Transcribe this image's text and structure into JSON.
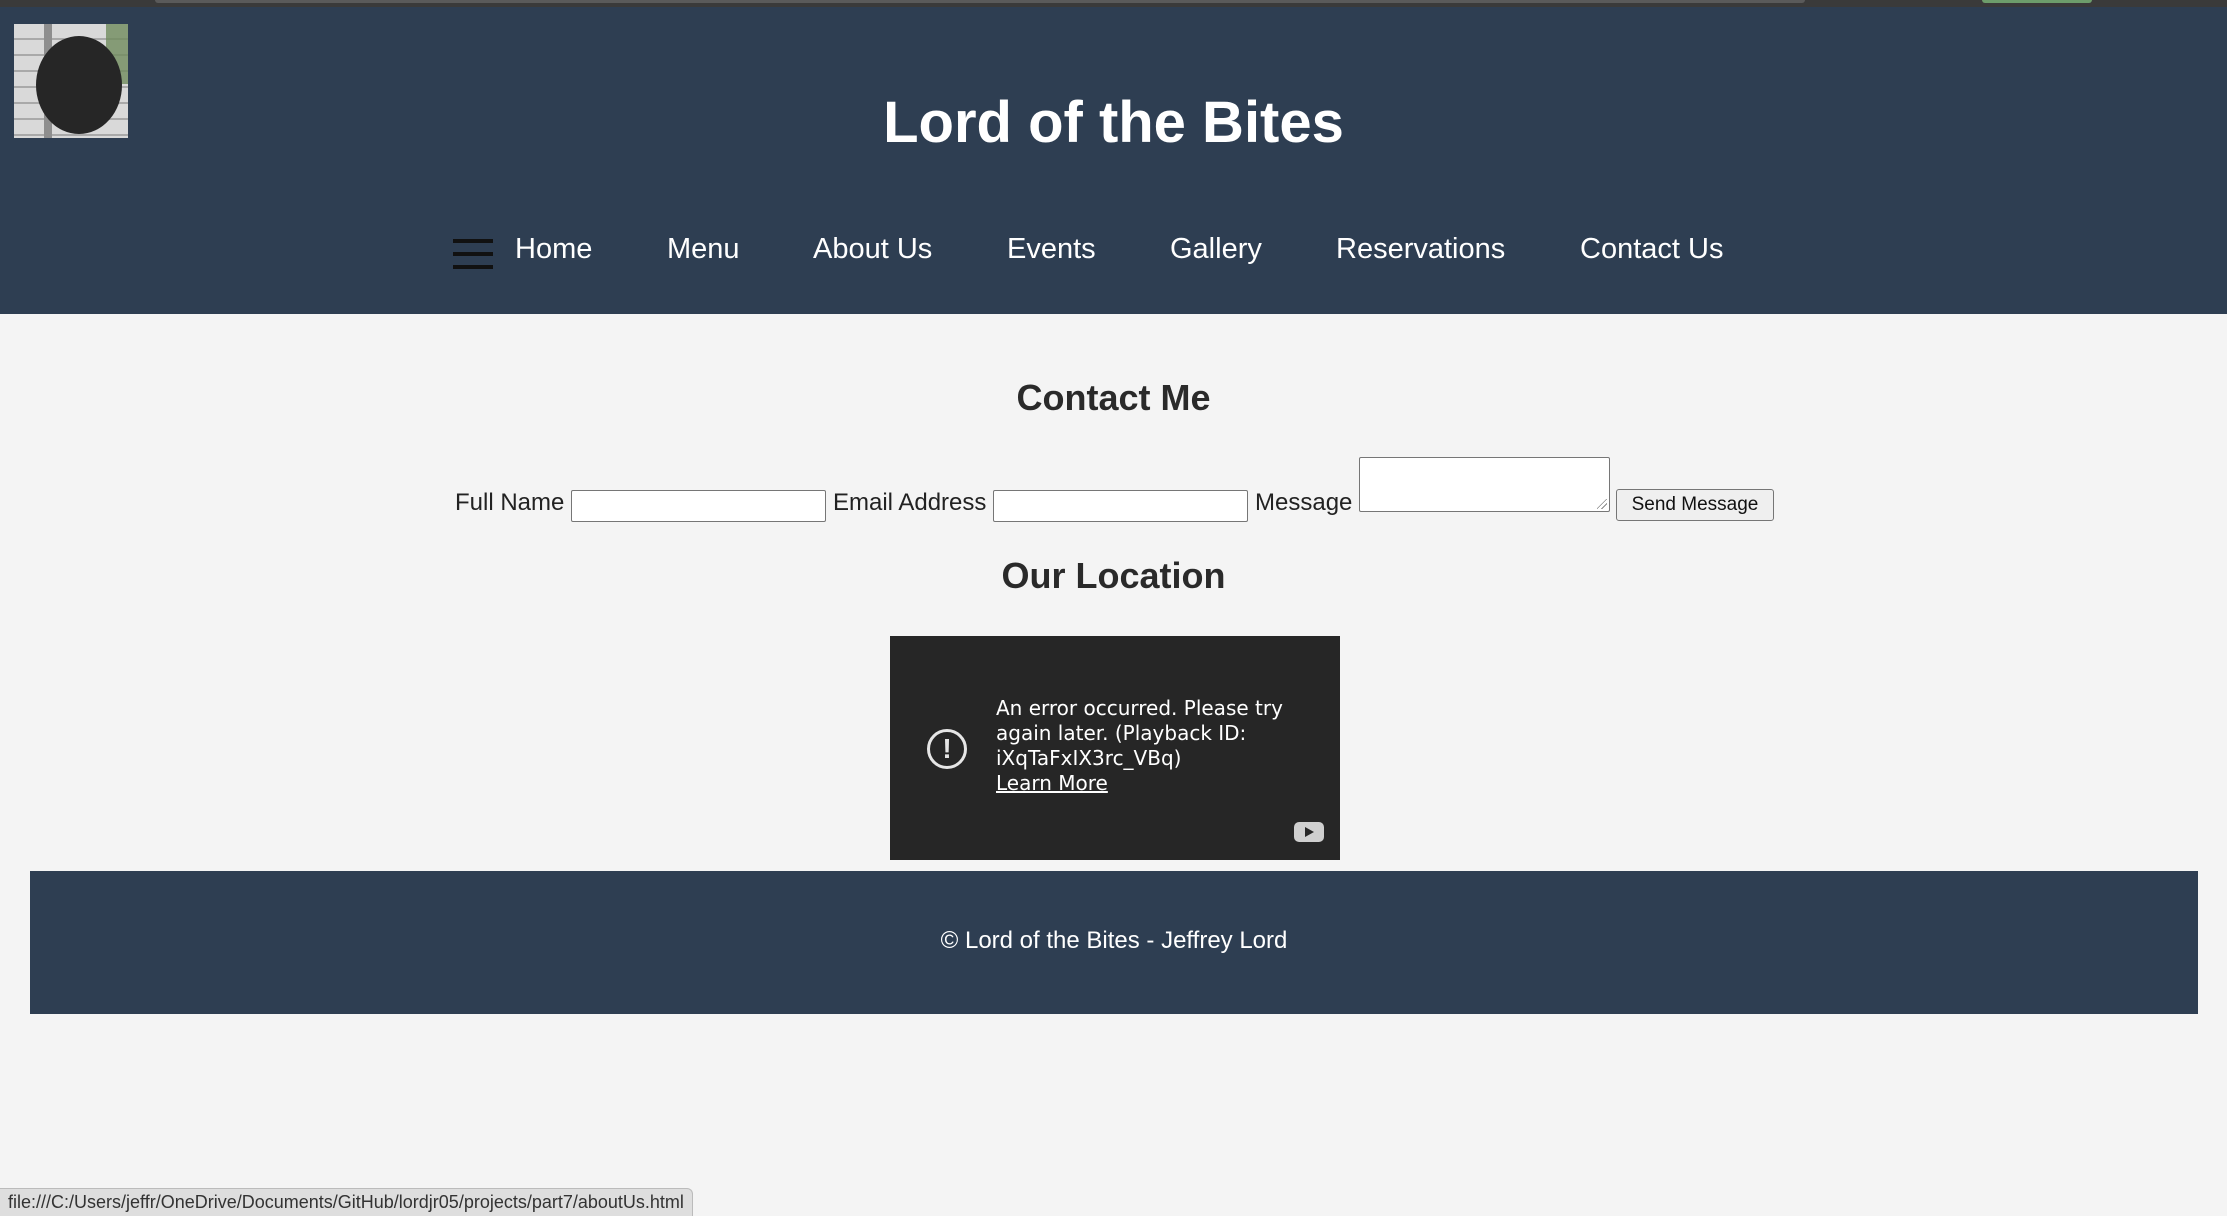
{
  "site": {
    "title": "Lord of the Bites",
    "logo_icon": "hanging-sign-logo"
  },
  "nav": {
    "menu_icon": "hamburger-icon",
    "links": [
      "Home",
      "Menu",
      "About Us",
      "Events",
      "Gallery",
      "Reservations",
      "Contact Us"
    ]
  },
  "contact": {
    "heading": "Contact Me",
    "full_name_label": "Full Name",
    "full_name_value": "",
    "email_label": "Email Address",
    "email_value": "",
    "message_label": "Message",
    "message_value": "",
    "send_label": "Send Message"
  },
  "location": {
    "heading": "Our Location",
    "video": {
      "error_icon": "alert-circle-icon",
      "error_message": "An error occurred. Please try again later. (Playback ID: iXqTaFxIX3rc_VBq)",
      "learn_more": "Learn More",
      "youtube_icon": "youtube-icon"
    }
  },
  "footer": {
    "text": "© Lord of the Bites - Jeffrey Lord"
  },
  "status_bar": {
    "url": "file:///C:/Users/jeffr/OneDrive/Documents/GitHub/lordjr05/projects/part7/aboutUs.html"
  },
  "colors": {
    "header_bg": "#2e3e52",
    "page_bg": "#f4f4f4",
    "video_bg": "#262626"
  }
}
